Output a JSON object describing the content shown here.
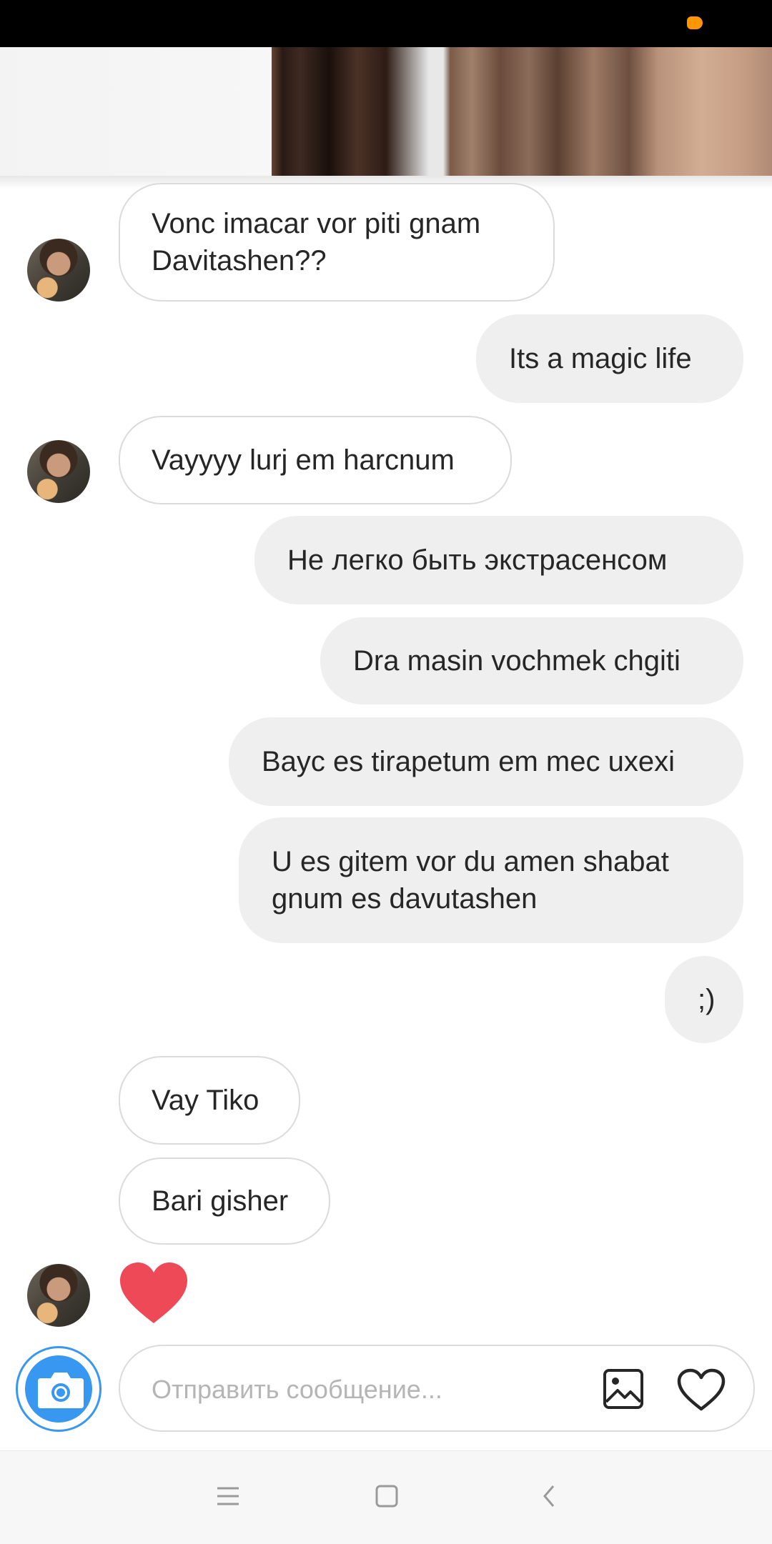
{
  "colors": {
    "accent": "#3897f0",
    "heart": "#ed4956",
    "bubble_out_bg": "#efefef",
    "bubble_in_border": "#dbdbdb",
    "battery": "#ff9500"
  },
  "messages": [
    {
      "side": "in",
      "text": "Vonc imacar vor piti gnam\nDavitashen??"
    },
    {
      "side": "out",
      "text": "Its a magic life"
    },
    {
      "side": "in",
      "text": "Vayyyy lurj em harcnum"
    },
    {
      "side": "out",
      "text": "Не легко быть экстрасенсом"
    },
    {
      "side": "out",
      "text": "Dra masin vochmek chgiti"
    },
    {
      "side": "out",
      "text": "Bayc es tirapetum em mec uxexi"
    },
    {
      "side": "out",
      "text": "U es gitem vor du amen shabat\ngnum es davutashen"
    },
    {
      "side": "out",
      "text": ";)"
    },
    {
      "side": "in",
      "text": "Vay Tiko"
    },
    {
      "side": "in",
      "text": "Bari gisher"
    },
    {
      "side": "in",
      "type": "heart",
      "icon": "heart-icon"
    }
  ],
  "composer": {
    "placeholder": "Отправить сообщение...",
    "camera_icon": "camera-icon",
    "gallery_icon": "gallery-icon",
    "like_icon": "heart-outline-icon"
  },
  "nav": {
    "menu_icon": "menu-icon",
    "home_icon": "home-square-icon",
    "back_icon": "back-chevron-icon"
  }
}
